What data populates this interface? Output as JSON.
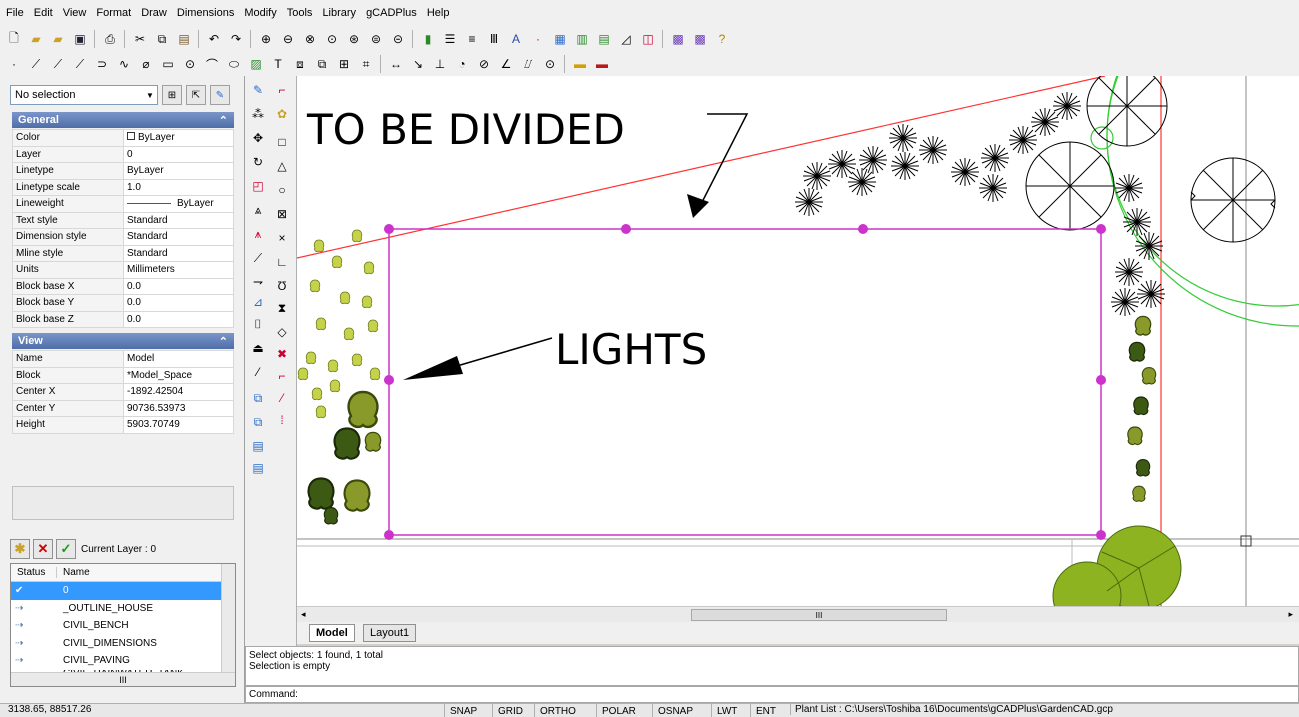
{
  "menubar": {
    "items": [
      "File",
      "Edit",
      "View",
      "Format",
      "Draw",
      "Dimensions",
      "Modify",
      "Tools",
      "Library",
      "gCADPlus",
      "Help"
    ]
  },
  "toolbar1": {
    "icons": [
      "new-file-icon",
      "open-folder-icon",
      "open-recent-icon",
      "save-icon",
      "print-icon",
      "cut-icon",
      "copy-icon",
      "paste-icon",
      "undo-icon",
      "redo-icon",
      "zoom-in-icon",
      "zoom-out-icon",
      "zoom-realtime-icon",
      "zoom-window-icon",
      "zoom-extents-icon",
      "zoom-previous-icon",
      "zoom-all-icon",
      "layer-colors-icon",
      "layer-manager-icon",
      "linetype-icon",
      "lineweight-icon",
      "text-style-icon",
      "point-icon",
      "grid-icon",
      "library-icon",
      "layout-icon",
      "measure-icon",
      "plant-list-icon",
      "plant-labels-icon",
      "report-icon",
      "help-icon"
    ]
  },
  "toolbar2": {
    "icons": [
      "point-draw-icon",
      "line-icon",
      "polyline-icon",
      "ray-icon",
      "arc-icon",
      "spline-icon",
      "freehand-icon",
      "rectangle-icon",
      "circle-icon",
      "arc-draw-icon",
      "ellipse-icon",
      "hatch-icon",
      "text-icon",
      "insert-block-icon",
      "block-attribute-icon",
      "table-icon",
      "wall-icon",
      "dimension-icon",
      "leader-icon",
      "ordinate-dim-icon",
      "radius-dim-icon",
      "diameter-dim-icon",
      "angular-dim-icon",
      "tolerance-dim-icon",
      "center-mark-icon",
      "line-color-icon",
      "fill-color-icon"
    ]
  },
  "properties": {
    "selection": "No selection",
    "general_title": "General",
    "general": [
      {
        "key": "Color",
        "value": "ByLayer"
      },
      {
        "key": "Layer",
        "value": "0"
      },
      {
        "key": "Linetype",
        "value": "ByLayer"
      },
      {
        "key": "Linetype scale",
        "value": "1.0"
      },
      {
        "key": "Lineweight",
        "value": "ByLayer"
      },
      {
        "key": "Text style",
        "value": "Standard"
      },
      {
        "key": "Dimension style",
        "value": "Standard"
      },
      {
        "key": "Mline style",
        "value": "Standard"
      },
      {
        "key": "Units",
        "value": "Millimeters"
      },
      {
        "key": "Block base X",
        "value": "0.0"
      },
      {
        "key": "Block base Y",
        "value": "0.0"
      },
      {
        "key": "Block base Z",
        "value": "0.0"
      }
    ],
    "view_title": "View",
    "view": [
      {
        "key": "Name",
        "value": "Model"
      },
      {
        "key": "Block",
        "value": "*Model_Space"
      },
      {
        "key": "Center X",
        "value": "-1892.42504"
      },
      {
        "key": "Center Y",
        "value": "90736.53973"
      },
      {
        "key": "Height",
        "value": "5903.70749"
      }
    ]
  },
  "layers": {
    "current_layer": "Current Layer : 0",
    "col_status": "Status",
    "col_name": "Name",
    "rows": [
      "0",
      "_OUTLINE_HOUSE",
      "CIVIL_BENCH",
      "CIVIL_DIMENSIONS",
      "CIVIL_PAVING",
      "CIVIL_RAINWATER_TANK"
    ],
    "hscroll_label": "III"
  },
  "canvas": {
    "annotation_top": "TO BE DIVIDED",
    "annotation_lights": "LIGHTS",
    "colors": {
      "selection": "#cc33cc",
      "boundary_red": "#ff3333",
      "circle_green": "#33cc33",
      "plant_olive": "#8a9a2a",
      "plant_dark": "#3c5a1a"
    }
  },
  "hscroll_label": "III",
  "tabs": [
    "Model",
    "Layout1"
  ],
  "command": {
    "history": [
      "Select objects: 1 found,  1 total",
      "Selection is empty"
    ],
    "prompt": "Command:"
  },
  "status": {
    "coords": "3138.65, 88517.26",
    "toggles": [
      "SNAP",
      "GRID",
      "ORTHO",
      "POLAR",
      "OSNAP",
      "LWT",
      "ENT"
    ],
    "plant_list": "Plant List : C:\\Users\\Toshiba 16\\Documents\\gCADPlus\\GardenCAD.gcp"
  }
}
